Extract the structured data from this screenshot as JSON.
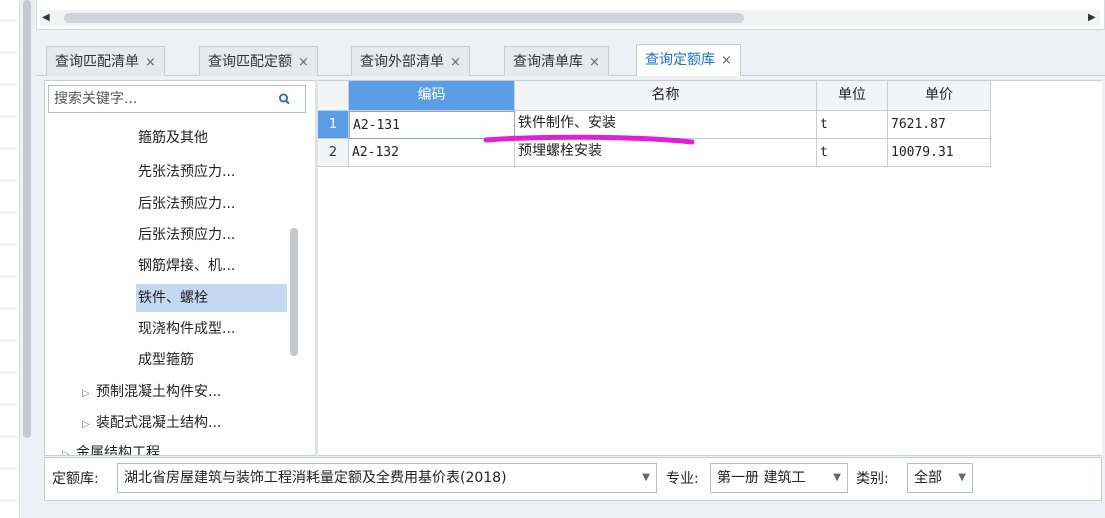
{
  "scrollbar": {
    "left_arrow": "◀",
    "right_arrow": "▶"
  },
  "tabs": [
    {
      "label": "查询匹配清单",
      "close": "×"
    },
    {
      "label": "查询匹配定额",
      "close": "×"
    },
    {
      "label": "查询外部清单",
      "close": "×"
    },
    {
      "label": "查询清单库",
      "close": "×"
    },
    {
      "label": "查询定额库",
      "close": "×",
      "active": true
    }
  ],
  "search": {
    "placeholder": "搜索关键字...",
    "icon": "search-icon"
  },
  "tree": [
    {
      "label": "箍筋及其他"
    },
    {
      "label": "先张法预应力..."
    },
    {
      "label": "后张法预应力..."
    },
    {
      "label": "后张法预应力..."
    },
    {
      "label": "钢筋焊接、机..."
    },
    {
      "label": "铁件、螺栓",
      "selected": true
    },
    {
      "label": "现浇构件成型..."
    },
    {
      "label": "成型箍筋"
    },
    {
      "label": "预制混凝土构件安...",
      "expander": "▷"
    },
    {
      "label": "装配式混凝土结构...",
      "expander": "▷"
    },
    {
      "label": "金属结构工程",
      "expander": "▷"
    }
  ],
  "grid": {
    "headers": {
      "code": "编码",
      "name": "名称",
      "unit": "单位",
      "price": "单价"
    },
    "rows": [
      {
        "num": "1",
        "code": "A2-131",
        "name": "铁件制作、安装",
        "unit": "t",
        "price": "7621.87"
      },
      {
        "num": "2",
        "code": "A2-132",
        "name": "预埋螺栓安装",
        "unit": "t",
        "price": "10079.31"
      }
    ]
  },
  "filters": {
    "quota_label": "定额库:",
    "quota_value": "湖北省房屋建筑与装饰工程消耗量定额及全费用基价表(2018)",
    "major_label": "专业:",
    "major_value": "第一册 建筑工",
    "category_label": "类别:",
    "category_value": "全部",
    "dropdown": "▼"
  },
  "colors": {
    "accent": "#5b9ee8",
    "active_tab_text": "#1a73c9",
    "annotation": "#e11fd6",
    "selection": "#c5d8f1"
  }
}
